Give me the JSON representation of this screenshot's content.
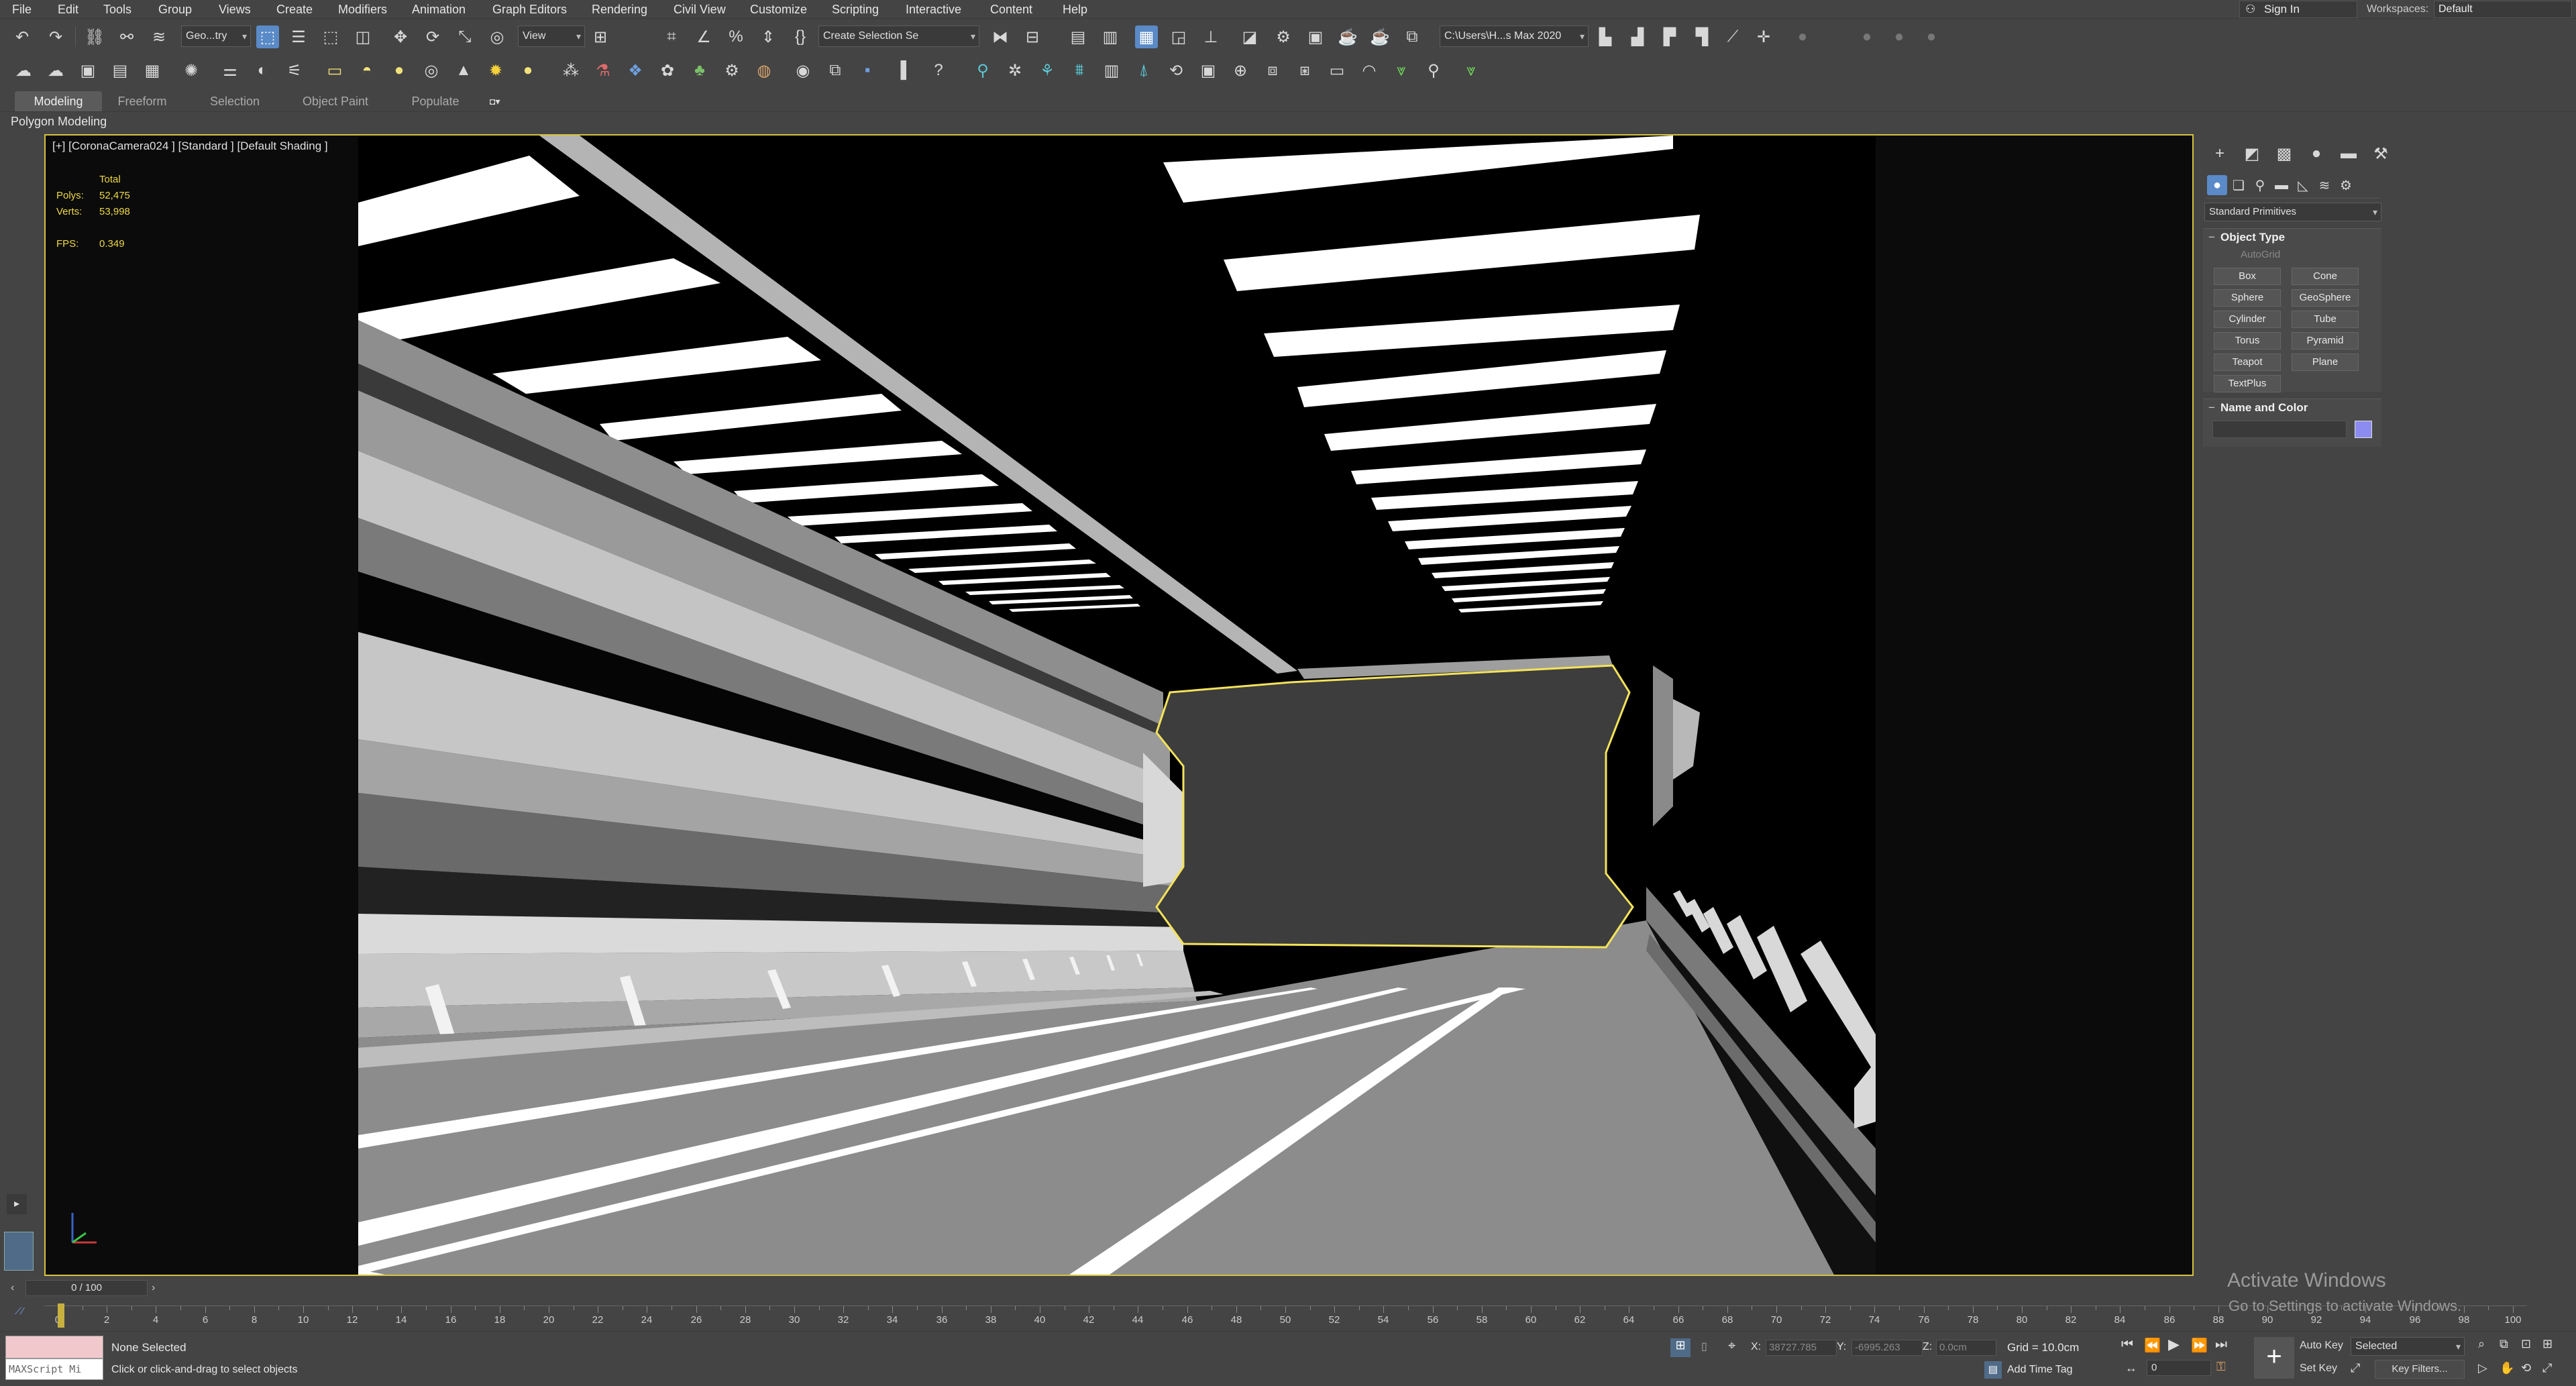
{
  "menu": [
    "File",
    "Edit",
    "Tools",
    "Group",
    "Views",
    "Create",
    "Modifiers",
    "Animation",
    "Graph Editors",
    "Rendering",
    "Civil View",
    "Customize",
    "Scripting",
    "Interactive",
    "Content",
    "Help"
  ],
  "account": {
    "sign_in": "Sign In",
    "workspaces_label": "Workspaces:",
    "workspace": "Default"
  },
  "toolbar1": {
    "selection_filter": "Geo...try",
    "ref_coord": "View",
    "named_selection": "Create Selection Se",
    "project_path": "C:\\Users\\H...s Max 2020"
  },
  "ribbon": {
    "tabs": [
      "Modeling",
      "Freeform",
      "Selection",
      "Object Paint",
      "Populate"
    ],
    "active": "Modeling",
    "sub_label": "Polygon Modeling"
  },
  "viewport": {
    "label": "[+] [CoronaCamera024 ] [Standard ] [Default Shading ]",
    "stats": {
      "total_label": "Total",
      "polys_label": "Polys:",
      "polys": "52,475",
      "verts_label": "Verts:",
      "verts": "53,998",
      "fps_label": "FPS:",
      "fps": "0.349"
    }
  },
  "command_panel": {
    "category": "Standard Primitives",
    "object_type_title": "Object Type",
    "autogrid": "AutoGrid",
    "buttons": [
      "Box",
      "Cone",
      "Sphere",
      "GeoSphere",
      "Cylinder",
      "Tube",
      "Torus",
      "Pyramid",
      "Teapot",
      "Plane",
      "TextPlus"
    ],
    "name_color_title": "Name and Color",
    "object_color": "#8c8cf0"
  },
  "timeline": {
    "slider": "0 / 100",
    "ticks": [
      "0",
      "2",
      "4",
      "6",
      "8",
      "10",
      "12",
      "14",
      "16",
      "18",
      "20",
      "22",
      "24",
      "26",
      "28",
      "30",
      "32",
      "34",
      "36",
      "38",
      "40",
      "42",
      "44",
      "46",
      "48",
      "50",
      "52",
      "54",
      "56",
      "58",
      "60",
      "62",
      "64",
      "66",
      "68",
      "70",
      "72",
      "74",
      "76",
      "78",
      "80",
      "82",
      "84",
      "86",
      "88",
      "90",
      "92",
      "94",
      "96",
      "98",
      "100"
    ]
  },
  "status": {
    "maxscript": "MAXScript Mi",
    "selection": "None Selected",
    "prompt": "Click or click-and-drag to select objects",
    "x_label": "X:",
    "x": "38727.785",
    "y_label": "Y:",
    "y": "-6995.263",
    "z_label": "Z:",
    "z": "0.0cm",
    "grid": "Grid = 10.0cm",
    "add_time_tag": "Add Time Tag",
    "auto_key": "Auto Key",
    "set_key": "Set Key",
    "key_mode": "Selected",
    "key_filters": "Key Filters...",
    "frame": "0"
  },
  "watermark": {
    "title": "Activate Windows",
    "subtitle": "Go to Settings to activate Windows."
  },
  "colors": {
    "viewport_border": "#d7c23d",
    "stats_text": "#f0d846",
    "accent": "#5a8ac7"
  }
}
